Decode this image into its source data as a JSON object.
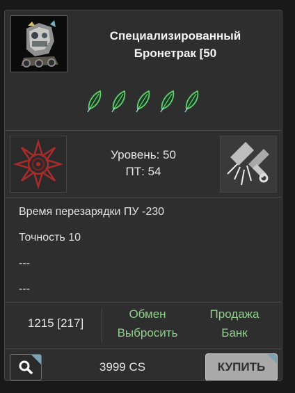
{
  "item": {
    "title_line1": "Специализированный",
    "title_line2": "Бронетрак [50",
    "thumbnail_icon": "armored-truck-icon",
    "grade_icons": [
      "leaf-grade-icon",
      "leaf-grade-icon",
      "leaf-grade-icon",
      "leaf-grade-icon",
      "leaf-grade-icon"
    ]
  },
  "stats": {
    "left_icon": "spiked-emblem-icon",
    "right_icon": "broken-bolt-icon",
    "level_text": "Уровень: 50",
    "pt_text": "ПТ: 54"
  },
  "properties": [
    "Время перезарядки ПУ -230",
    "Точность 10",
    "---",
    "---"
  ],
  "actions": {
    "count": "1215 [217]",
    "exchange": "Обмен",
    "discard": "Выбросить",
    "sell": "Продажа",
    "bank": "Банк"
  },
  "footer": {
    "search_icon": "search-icon",
    "price": "3999 CS",
    "buy_label": "КУПИТЬ"
  },
  "colors": {
    "panel_bg": "#2e2e2e",
    "action_green": "#8fd08a",
    "accent_corner": "#7ea2b5",
    "grade_green": "#5fd06c"
  }
}
